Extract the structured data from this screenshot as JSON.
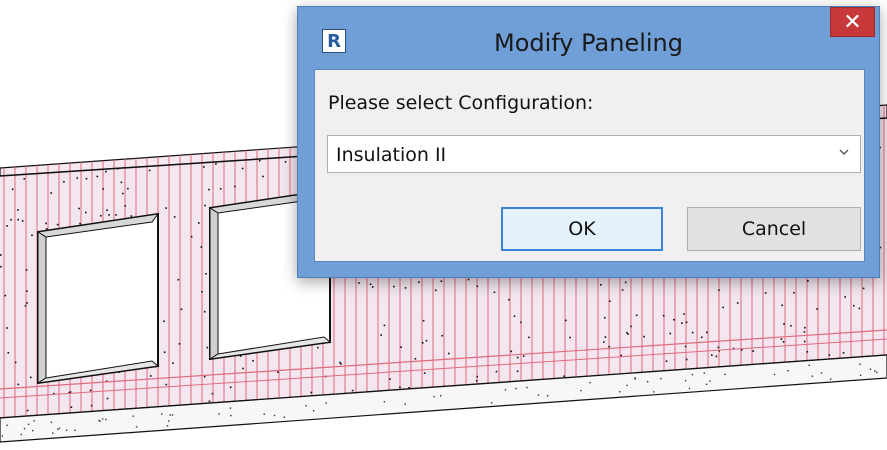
{
  "dialog": {
    "title": "Modify Paneling",
    "app_icon_letter": "R",
    "close_symbol": "✕",
    "prompt": "Please select Configuration:",
    "configuration": {
      "selected": "Insulation II"
    },
    "ok_label": "OK",
    "cancel_label": "Cancel"
  },
  "colors": {
    "titlebar": "#6f9fd6",
    "close_button": "#c7383b",
    "wall_fill": "#f3e6ef",
    "panel_lines": "#e06a7d"
  },
  "icons": [
    "revit-app-icon",
    "close-icon",
    "chevron-down-icon"
  ]
}
